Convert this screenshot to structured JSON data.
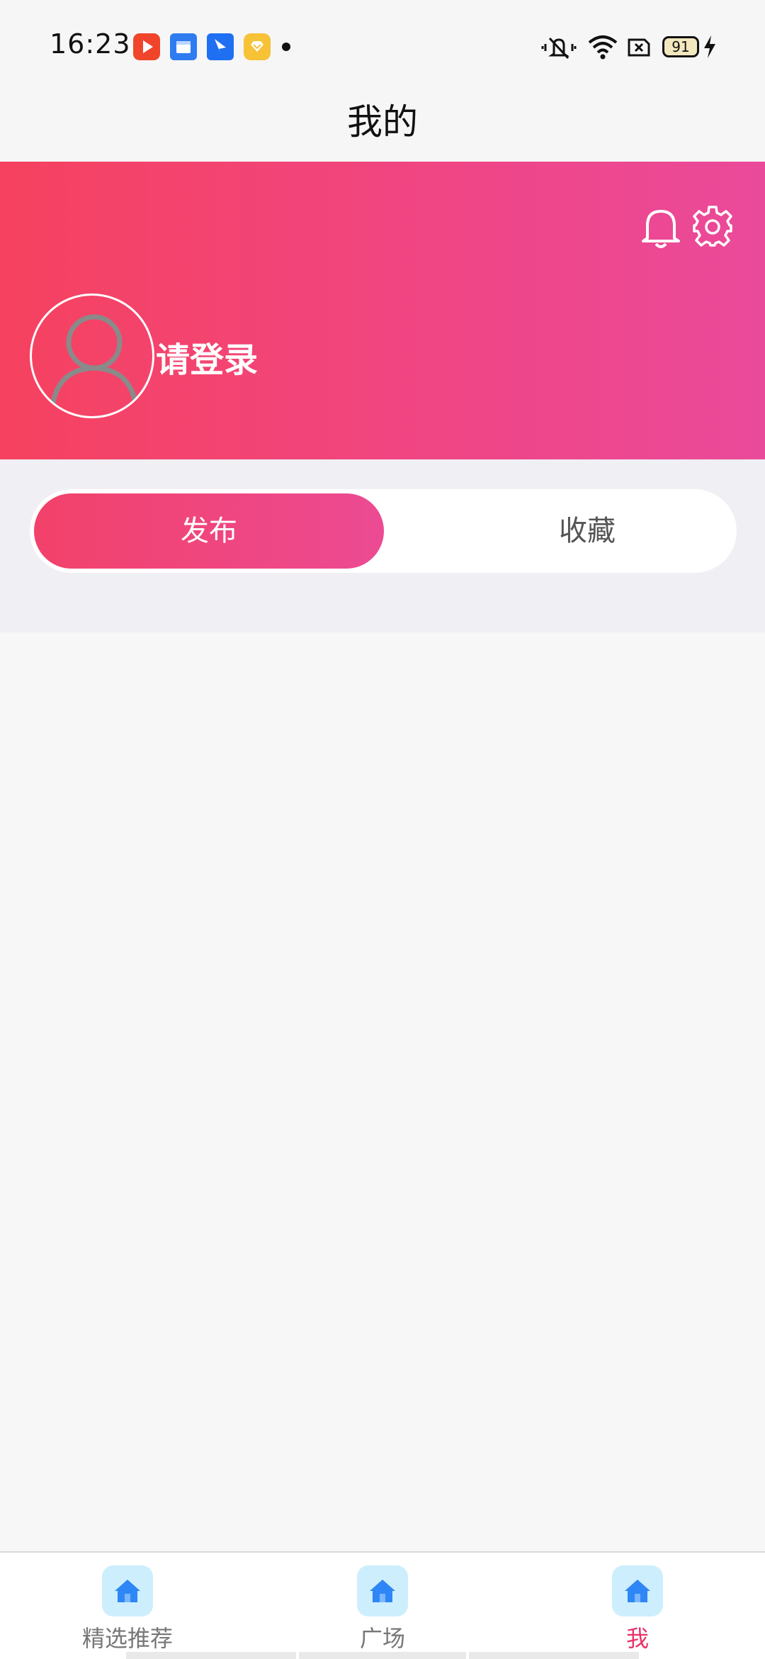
{
  "status_bar": {
    "time": "16:23",
    "battery": "91",
    "icons": [
      "video-app-icon",
      "files-app-icon",
      "feishu-app-icon",
      "gift-app-icon",
      "mute-icon",
      "wifi-icon",
      "sim-icon",
      "battery-icon",
      "charging-icon"
    ]
  },
  "header": {
    "title": "我的"
  },
  "profile": {
    "login_prompt": "请登录",
    "icons": [
      "bell-icon",
      "gear-icon",
      "avatar-placeholder-icon"
    ]
  },
  "tabs": [
    {
      "label": "发布",
      "active": true
    },
    {
      "label": "收藏",
      "active": false
    }
  ],
  "bottom_nav": [
    {
      "label": "精选推荐",
      "icon": "home-icon",
      "active": false
    },
    {
      "label": "广场",
      "icon": "home-icon",
      "active": false
    },
    {
      "label": "我",
      "icon": "home-icon",
      "active": true
    }
  ],
  "colors": {
    "gradient_start": "#f6425f",
    "gradient_end": "#ea4a9a",
    "active_nav": "#e8336b",
    "icon_bg": "#cdeefd",
    "icon_blue": "#2f86f6"
  }
}
